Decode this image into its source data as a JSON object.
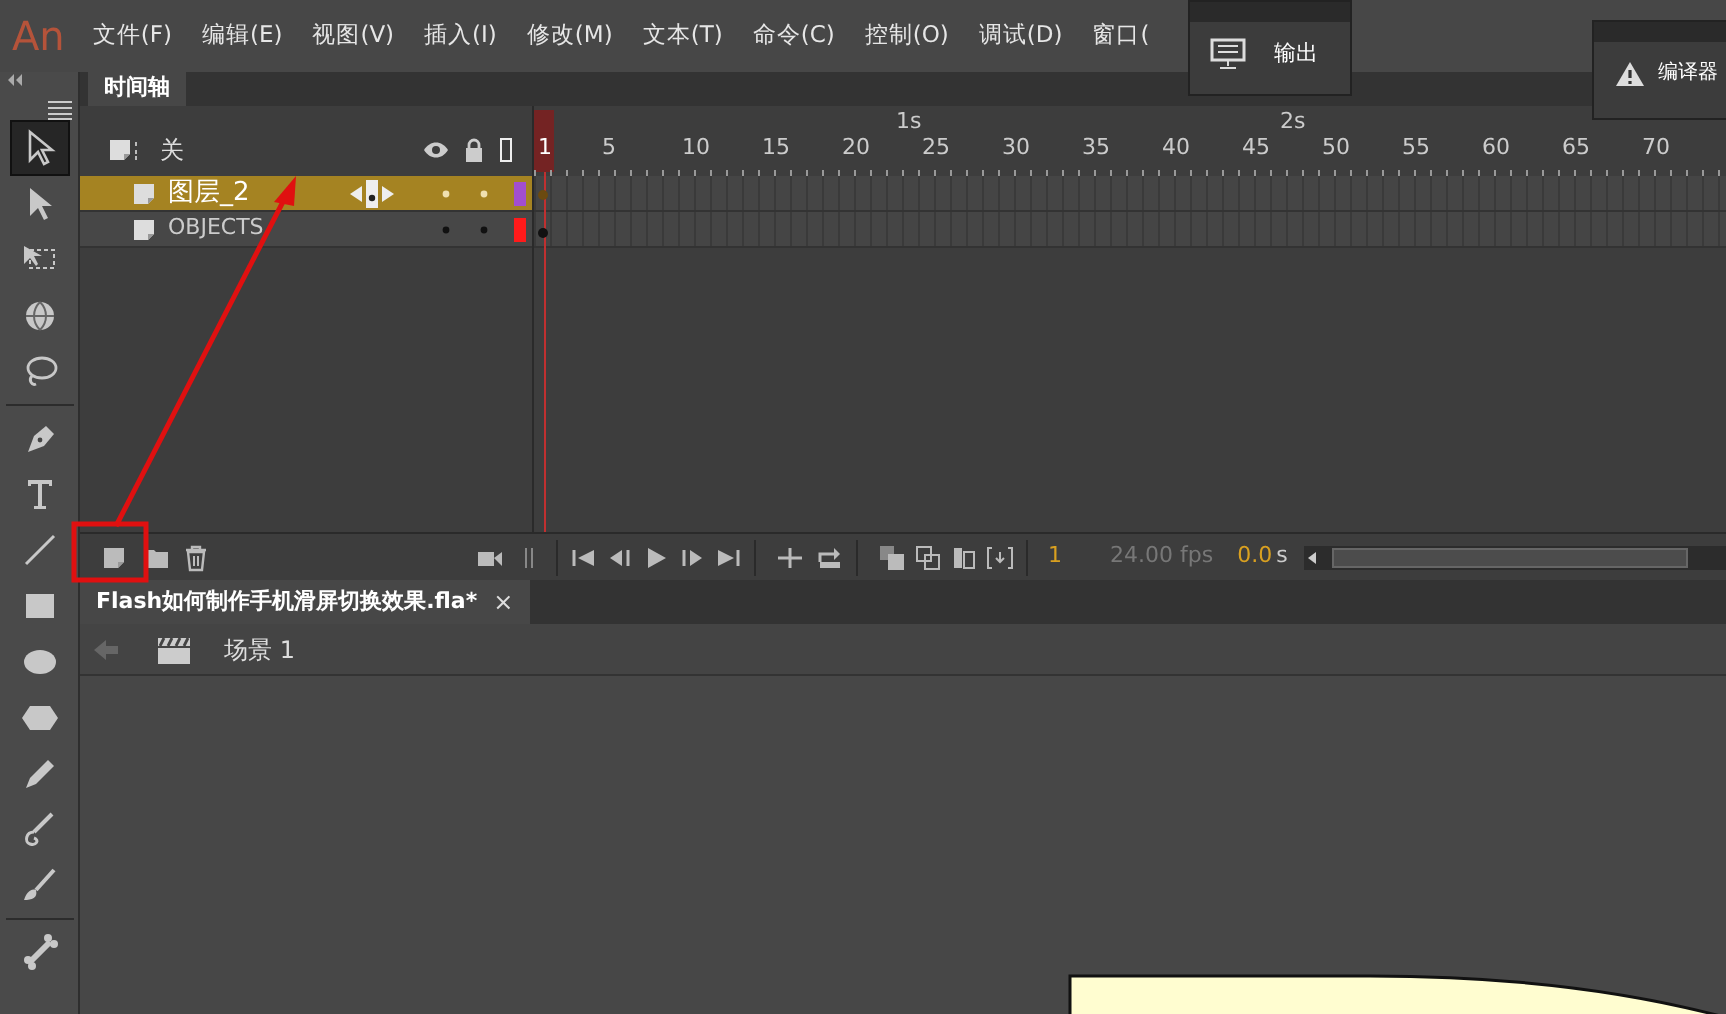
{
  "menubar": {
    "logo": "An",
    "items": [
      "文件(F)",
      "编辑(E)",
      "视图(V)",
      "插入(I)",
      "修改(M)",
      "文本(T)",
      "命令(C)",
      "控制(O)",
      "调试(D)",
      "窗口("
    ]
  },
  "floating_panels": [
    {
      "kind": "output",
      "title": "输出"
    },
    {
      "kind": "warning",
      "title": "编译器"
    }
  ],
  "tool_groups": [
    [
      {
        "kind": "arrow",
        "selected": true
      },
      {
        "kind": "subselect",
        "selected": false
      },
      {
        "kind": "transform",
        "selected": false
      },
      {
        "kind": "globe",
        "selected": false
      },
      {
        "kind": "lasso",
        "selected": false
      }
    ],
    [
      {
        "kind": "pen",
        "selected": false
      },
      {
        "kind": "text",
        "selected": false
      },
      {
        "kind": "line",
        "selected": false
      },
      {
        "kind": "rect",
        "selected": false
      },
      {
        "kind": "oval",
        "selected": false
      },
      {
        "kind": "poly",
        "selected": false
      },
      {
        "kind": "pencil",
        "selected": false
      },
      {
        "kind": "paint",
        "selected": false
      },
      {
        "kind": "brush",
        "selected": false
      }
    ],
    [
      {
        "kind": "bone",
        "selected": false
      }
    ]
  ],
  "timeline": {
    "tab": "时间轴",
    "header_label": "关",
    "ruler": {
      "frames": [
        "1",
        "5",
        "10",
        "15",
        "20",
        "25",
        "30",
        "35",
        "40",
        "45",
        "50",
        "55",
        "60",
        "65",
        "70"
      ],
      "seconds": [
        "1s",
        "2s"
      ]
    },
    "layers": [
      {
        "name": "图层_2",
        "selected": true,
        "color": "#a24ed0"
      },
      {
        "name": "OBJECTS",
        "selected": false,
        "color": "#ff1a1a"
      }
    ],
    "controls": {
      "current_frame": "1",
      "fps": "24.00 fps",
      "time": "0.0",
      "time_unit": "s"
    }
  },
  "document": {
    "tab": "Flash如何制作手机滑屏切换效果.fla*",
    "close": "×",
    "scene": "场景",
    "scene_number": "1"
  }
}
